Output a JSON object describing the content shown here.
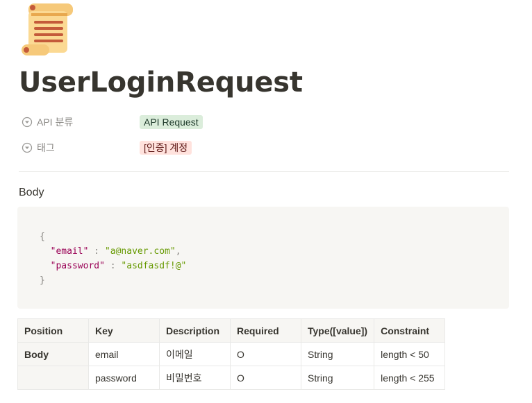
{
  "page": {
    "icon": "scroll-icon",
    "title": "UserLoginRequest"
  },
  "properties": [
    {
      "icon": "select-property-icon",
      "label": "API 분류",
      "value": "API Request",
      "color": "#dbeddb"
    },
    {
      "icon": "select-property-icon",
      "label": "태그",
      "value": "[인증] 계정",
      "color": "#ffe2dd"
    }
  ],
  "section": {
    "heading": "Body"
  },
  "code": {
    "open_brace": "{",
    "lines": [
      {
        "key": "\"email\"",
        "sep": " : ",
        "value": "\"a@naver.com\"",
        "trail": ","
      },
      {
        "key": "\"password\"",
        "sep": " : ",
        "value": "\"asdfasdf!@\"",
        "trail": ""
      }
    ],
    "close_brace": "}"
  },
  "table": {
    "headers": [
      "Position",
      "Key",
      "Description",
      "Required",
      "Type([value])",
      "Constraint"
    ],
    "rows": [
      [
        "Body",
        "email",
        "이메일",
        "O",
        "String",
        "length < 50"
      ],
      [
        "",
        "password",
        "비밀번호",
        "O",
        "String",
        "length < 255"
      ]
    ]
  }
}
